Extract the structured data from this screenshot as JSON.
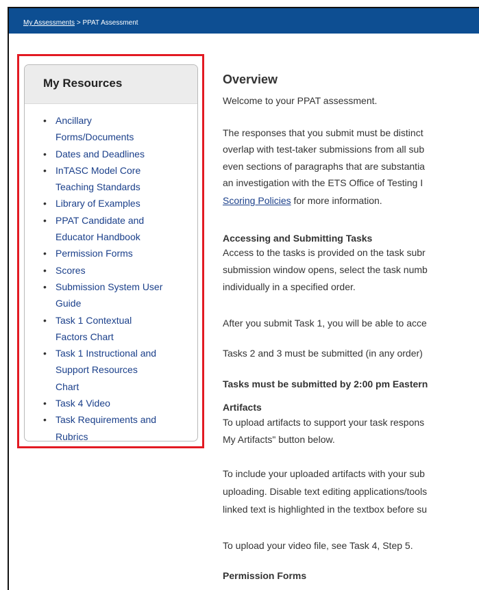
{
  "breadcrumb": {
    "link": "My Assessments",
    "separator": ">",
    "current": "PPAT Assessment"
  },
  "resources": {
    "title": "My Resources",
    "items": [
      {
        "lines": [
          "Ancillary",
          "Forms/Documents"
        ]
      },
      {
        "lines": [
          "Dates and Deadlines"
        ]
      },
      {
        "lines": [
          "InTASC Model Core",
          "Teaching Standards"
        ]
      },
      {
        "lines": [
          "Library of Examples"
        ]
      },
      {
        "lines": [
          "PPAT Candidate and",
          "Educator Handbook"
        ]
      },
      {
        "lines": [
          "Permission Forms"
        ]
      },
      {
        "lines": [
          "Scores"
        ]
      },
      {
        "lines": [
          "Submission System User",
          "Guide"
        ]
      },
      {
        "lines": [
          "Task 1 Contextual",
          "Factors Chart"
        ]
      },
      {
        "lines": [
          "Task 1 Instructional and",
          "Support Resources",
          "Chart"
        ]
      },
      {
        "lines": [
          "Task 4 Video"
        ]
      },
      {
        "lines": [
          "Task Requirements and",
          "Rubrics"
        ]
      }
    ]
  },
  "main": {
    "overview_heading": "Overview",
    "welcome": "Welcome to your PPAT assessment.",
    "p1": [
      "The responses that you submit must be distinct",
      "overlap with test-taker submissions from all sub",
      "even sections of paragraphs that are substantia",
      "an investigation with the ETS Office of Testing I"
    ],
    "p1_link": "Scoring Policies",
    "p1_tail": " for more information.",
    "accessing_heading": "Accessing and Submitting Tasks",
    "access": [
      "Access to the tasks is provided on the task subr",
      "submission window opens, select the task numb",
      "individually in a specified order."
    ],
    "after_task1": "After you submit Task 1, you will be able to acce",
    "tasks23": "Tasks 2 and 3 must be submitted (in any order)",
    "deadline": "Tasks must be submitted by 2:00 pm Eastern",
    "artifacts_heading": "Artifacts",
    "artifacts": [
      "To upload artifacts to support your task respons",
      "My Artifacts\" button below."
    ],
    "include": [
      "To include your uploaded artifacts with your sub",
      "uploading. Disable text editing applications/tools",
      "linked text is highlighted in the textbox before su"
    ],
    "video": "To upload your video file, see Task 4, Step 5.",
    "permission_heading": "Permission Forms"
  }
}
